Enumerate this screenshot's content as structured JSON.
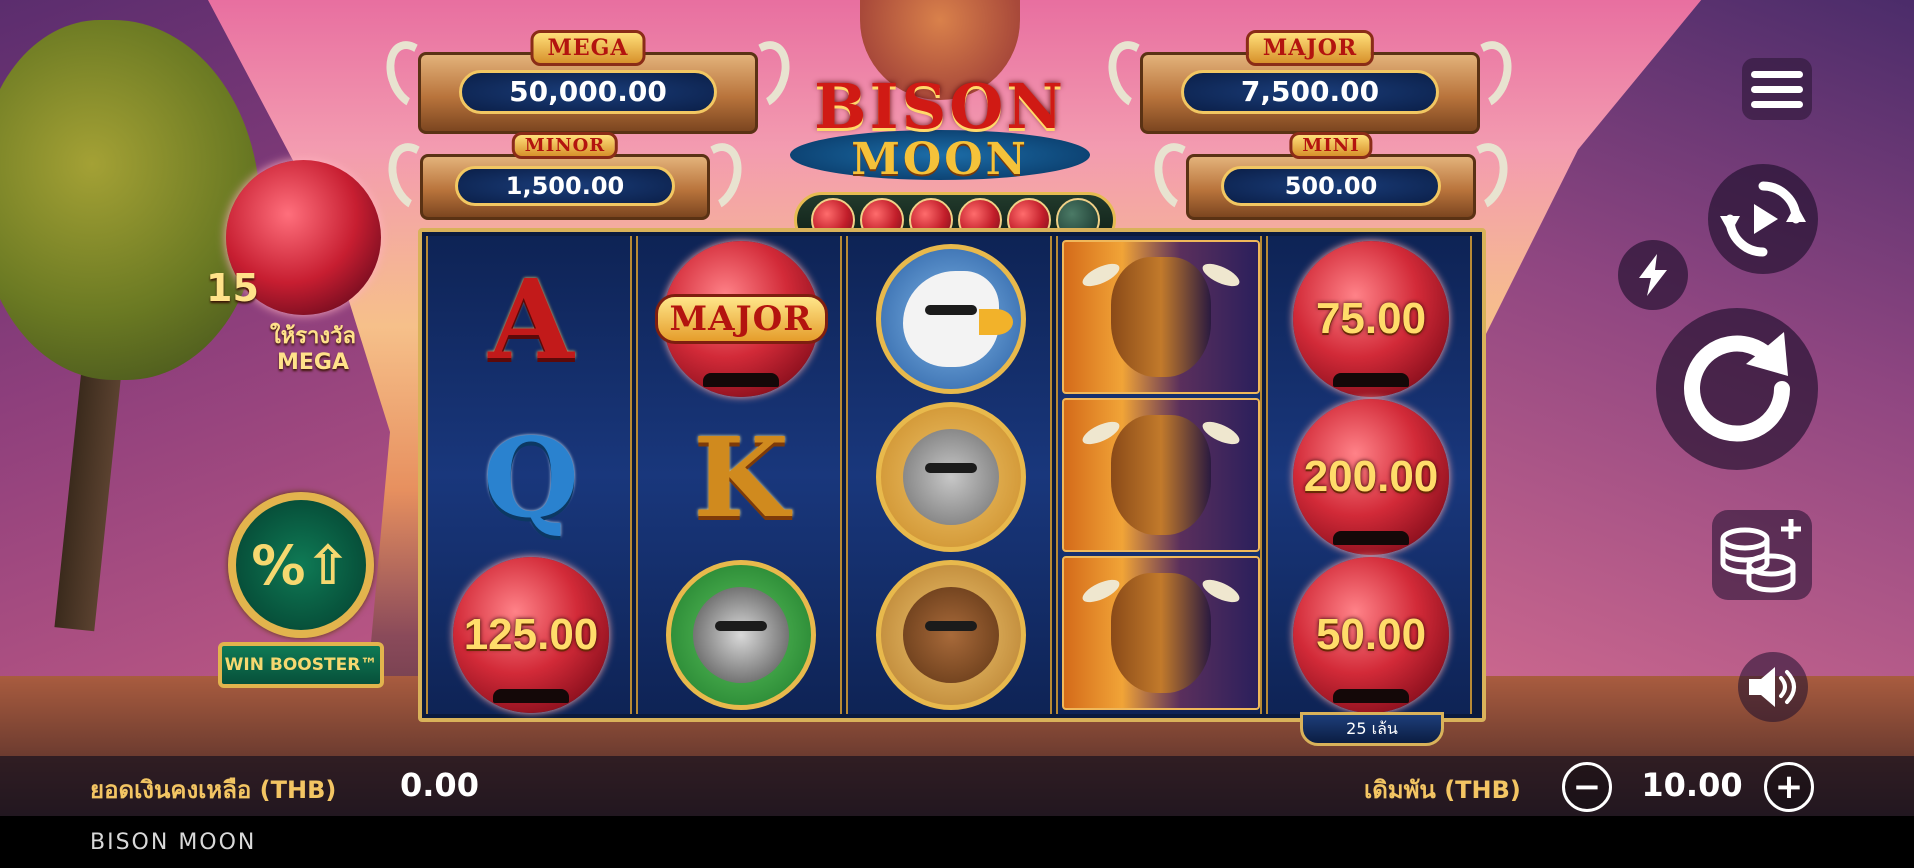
{
  "game": {
    "title_line1": "BISON",
    "title_line2": "MOON"
  },
  "jackpots": [
    {
      "name": "MEGA",
      "value": "50,000.00"
    },
    {
      "name": "MINOR",
      "value": "1,500.00"
    },
    {
      "name": "MAJOR",
      "value": "7,500.00"
    },
    {
      "name": "MINI",
      "value": "500.00"
    }
  ],
  "moon_meter": {
    "collected": 5,
    "total": 6
  },
  "feature": {
    "count": "15",
    "label_line1": "ให้รางวัล",
    "label_line2": "MEGA"
  },
  "win_booster": {
    "icon": "%⇧",
    "label": "WIN BOOSTER™"
  },
  "reels": {
    "r1": [
      "A",
      "Q",
      "125.00"
    ],
    "r2": [
      "MAJOR",
      "K",
      "raccoon"
    ],
    "r3": [
      "eagle",
      "wolf",
      "bear"
    ],
    "r4": [
      "bison",
      "bison",
      "bison"
    ],
    "r5": [
      "75.00",
      "200.00",
      "50.00"
    ]
  },
  "lines": "25 เล้น",
  "controls": {
    "menu_icon": "hamburger-menu-icon",
    "autoplay_icon": "autoplay-icon",
    "turbo_icon": "lightning-icon",
    "spin_icon": "spin-icon",
    "bet_icon": "coins-plus-icon",
    "sound_icon": "speaker-icon"
  },
  "bottom_bar": {
    "balance_label": "ยอดเงินคงเหลือ (THB)",
    "balance_value": "0.00",
    "bet_label": "เดิมพัน (THB)",
    "bet_value": "10.00",
    "minus": "−",
    "plus": "+"
  },
  "footer": {
    "title": "BISON MOON"
  },
  "colors": {
    "gold": "#f3c563",
    "reel_bg": "#0e2355",
    "moon_red": "#c71e31"
  }
}
